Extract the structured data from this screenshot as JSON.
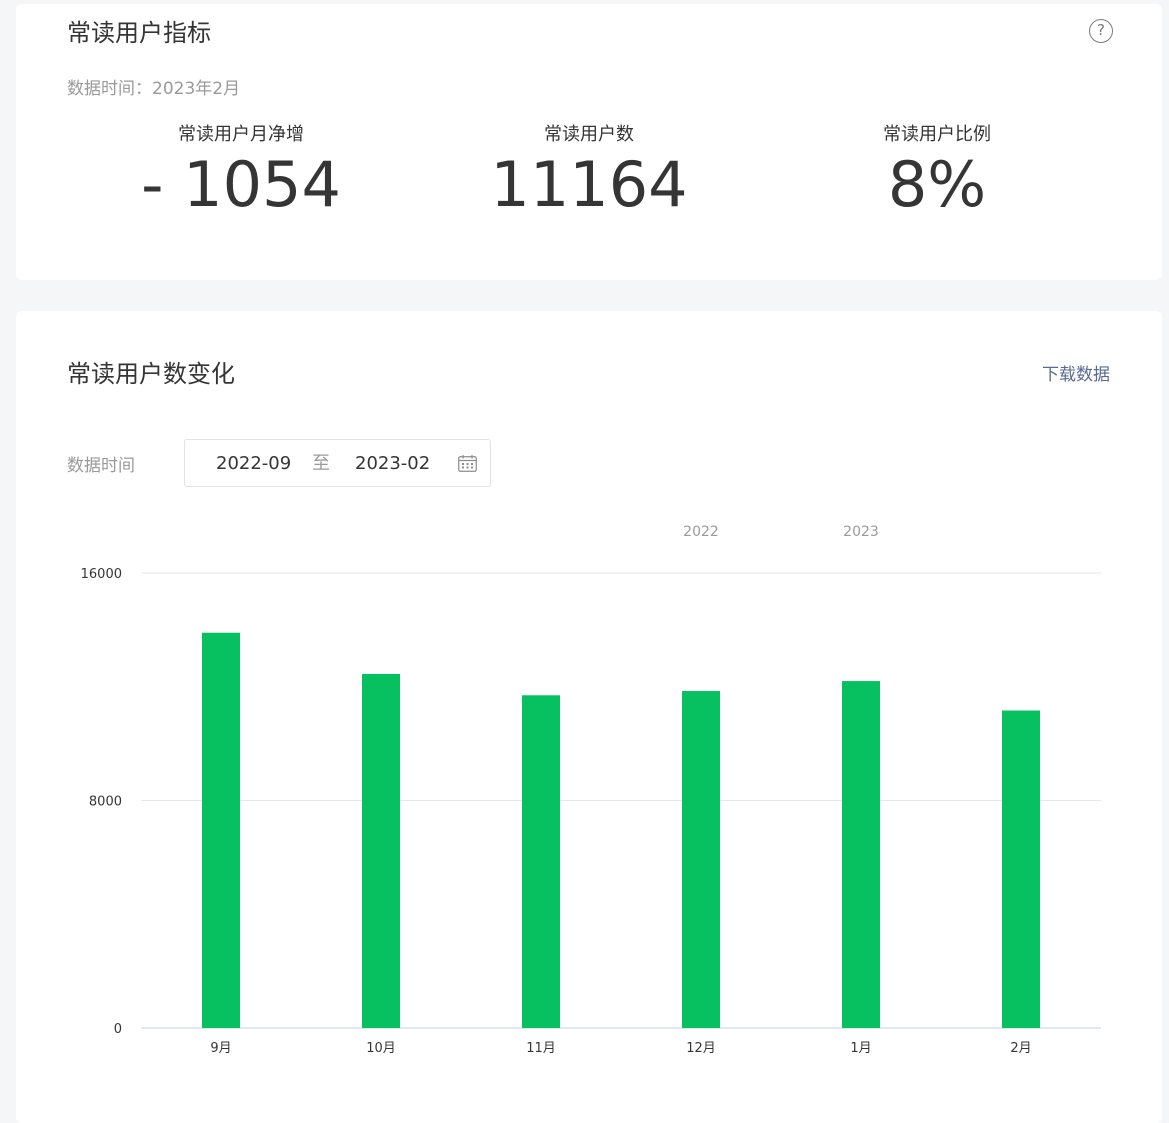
{
  "summary": {
    "title": "常读用户指标",
    "data_time": "数据时间：2023年2月",
    "help_icon": "?",
    "metrics": [
      {
        "label": "常读用户月净增",
        "value": "- 1054"
      },
      {
        "label": "常读用户数",
        "value": "11164"
      },
      {
        "label": "常读用户比例",
        "value": "8%"
      }
    ]
  },
  "trend": {
    "title": "常读用户数变化",
    "download_label": "下载数据",
    "filter_label": "数据时间",
    "range": {
      "start": "2022-09",
      "separator": "至",
      "end": "2023-02"
    }
  },
  "chart_data": {
    "type": "bar",
    "categories": [
      "9月",
      "10月",
      "11月",
      "12月",
      "1月",
      "2月"
    ],
    "values": [
      13900,
      12450,
      11700,
      11850,
      12200,
      11164
    ],
    "year_labels": [
      {
        "label": "2022",
        "category_index": 3
      },
      {
        "label": "2023",
        "category_index": 4
      }
    ],
    "ylim": [
      0,
      16000
    ],
    "yticks": [
      0,
      8000,
      16000
    ],
    "colors": {
      "bar": "#07c160",
      "grid": "#e7e7e7",
      "axis": "#c9d3dd",
      "tick_text": "#353535",
      "year_text": "#9a9a9a"
    }
  }
}
